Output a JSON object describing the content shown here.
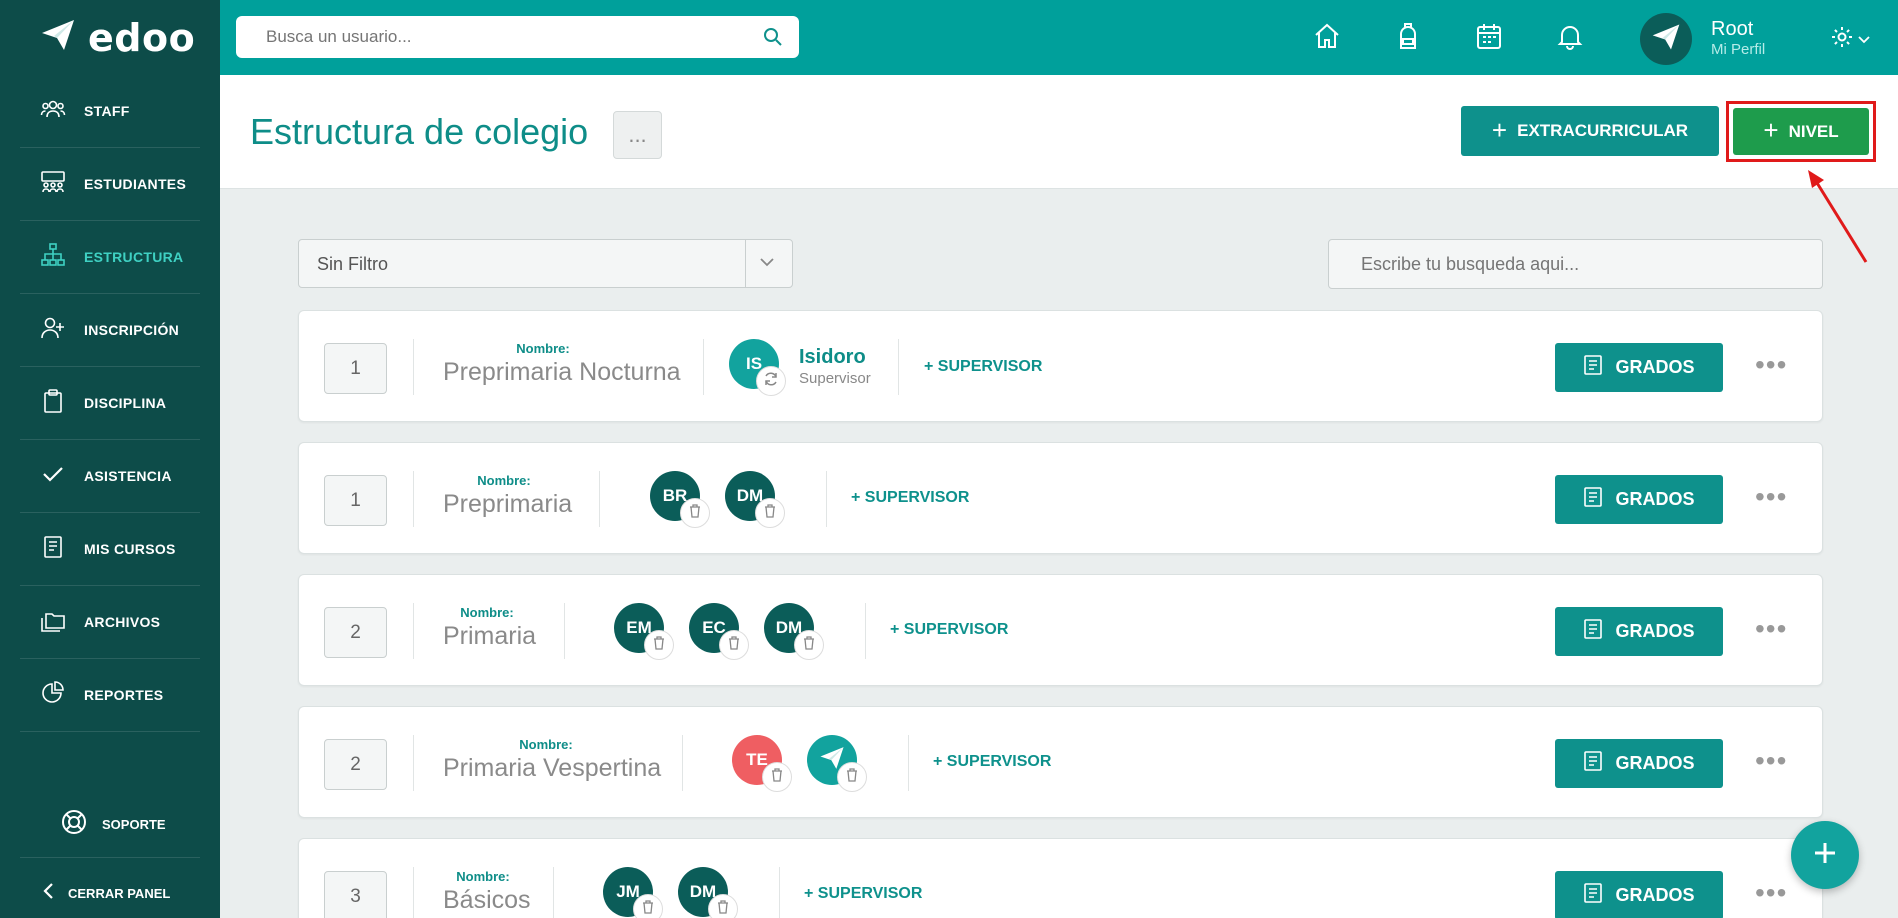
{
  "app": {
    "name": "edoo"
  },
  "sidebar": {
    "items": [
      {
        "label": "STAFF",
        "icon": "staff-icon",
        "active": false
      },
      {
        "label": "ESTUDIANTES",
        "icon": "students-icon",
        "active": false
      },
      {
        "label": "ESTRUCTURA",
        "icon": "structure-icon",
        "active": true
      },
      {
        "label": "INSCRIPCIÓN",
        "icon": "add-user-icon",
        "active": false
      },
      {
        "label": "DISCIPLINA",
        "icon": "clipboard-icon",
        "active": false
      },
      {
        "label": "ASISTENCIA",
        "icon": "check-icon",
        "active": false
      },
      {
        "label": "MIS CURSOS",
        "icon": "book-icon",
        "active": false
      },
      {
        "label": "ARCHIVOS",
        "icon": "folder-icon",
        "active": false
      },
      {
        "label": "REPORTES",
        "icon": "pie-chart-icon",
        "active": false
      }
    ],
    "support_label": "SOPORTE",
    "close_label": "CERRAR PANEL"
  },
  "topbar": {
    "search_placeholder": "Busca un usuario...",
    "user_name": "Root",
    "user_sub": "Mi Perfil"
  },
  "header": {
    "title": "Estructura de colegio",
    "more_label": "...",
    "extracurricular_label": "EXTRACURRICULAR",
    "nivel_label": "NIVEL"
  },
  "filters": {
    "select_value": "Sin Filtro",
    "search_placeholder": "Escribe tu busqueda aqui..."
  },
  "levels": [
    {
      "num": "1",
      "name_label": "Nombre:",
      "name": "Preprimaria Nocturna",
      "supervisor_name": "Isidoro",
      "supervisor_role": "Supervisor",
      "avatars": [
        "IS"
      ],
      "add_label": "+ SUPERVISOR",
      "grados_label": "GRADOS"
    },
    {
      "num": "1",
      "name_label": "Nombre:",
      "name": "Preprimaria",
      "avatars": [
        "BR",
        "DM"
      ],
      "add_label": "+ SUPERVISOR",
      "grados_label": "GRADOS"
    },
    {
      "num": "2",
      "name_label": "Nombre:",
      "name": "Primaria",
      "avatars": [
        "EM",
        "EC",
        "DM"
      ],
      "add_label": "+ SUPERVISOR",
      "grados_label": "GRADOS"
    },
    {
      "num": "2",
      "name_label": "Nombre:",
      "name": "Primaria Vespertina",
      "avatars": [
        "TE",
        ""
      ],
      "add_label": "+ SUPERVISOR",
      "grados_label": "GRADOS"
    },
    {
      "num": "3",
      "name_label": "Nombre:",
      "name": "Básicos",
      "avatars": [
        "JM",
        "DM"
      ],
      "add_label": "+ SUPERVISOR",
      "grados_label": "GRADOS"
    }
  ],
  "colors": {
    "sidebar": "#0d4c49",
    "topbar": "#00a09b",
    "primary": "#0e918c",
    "nivel_green": "#1e9c4c",
    "highlight": "#e01a1a"
  }
}
